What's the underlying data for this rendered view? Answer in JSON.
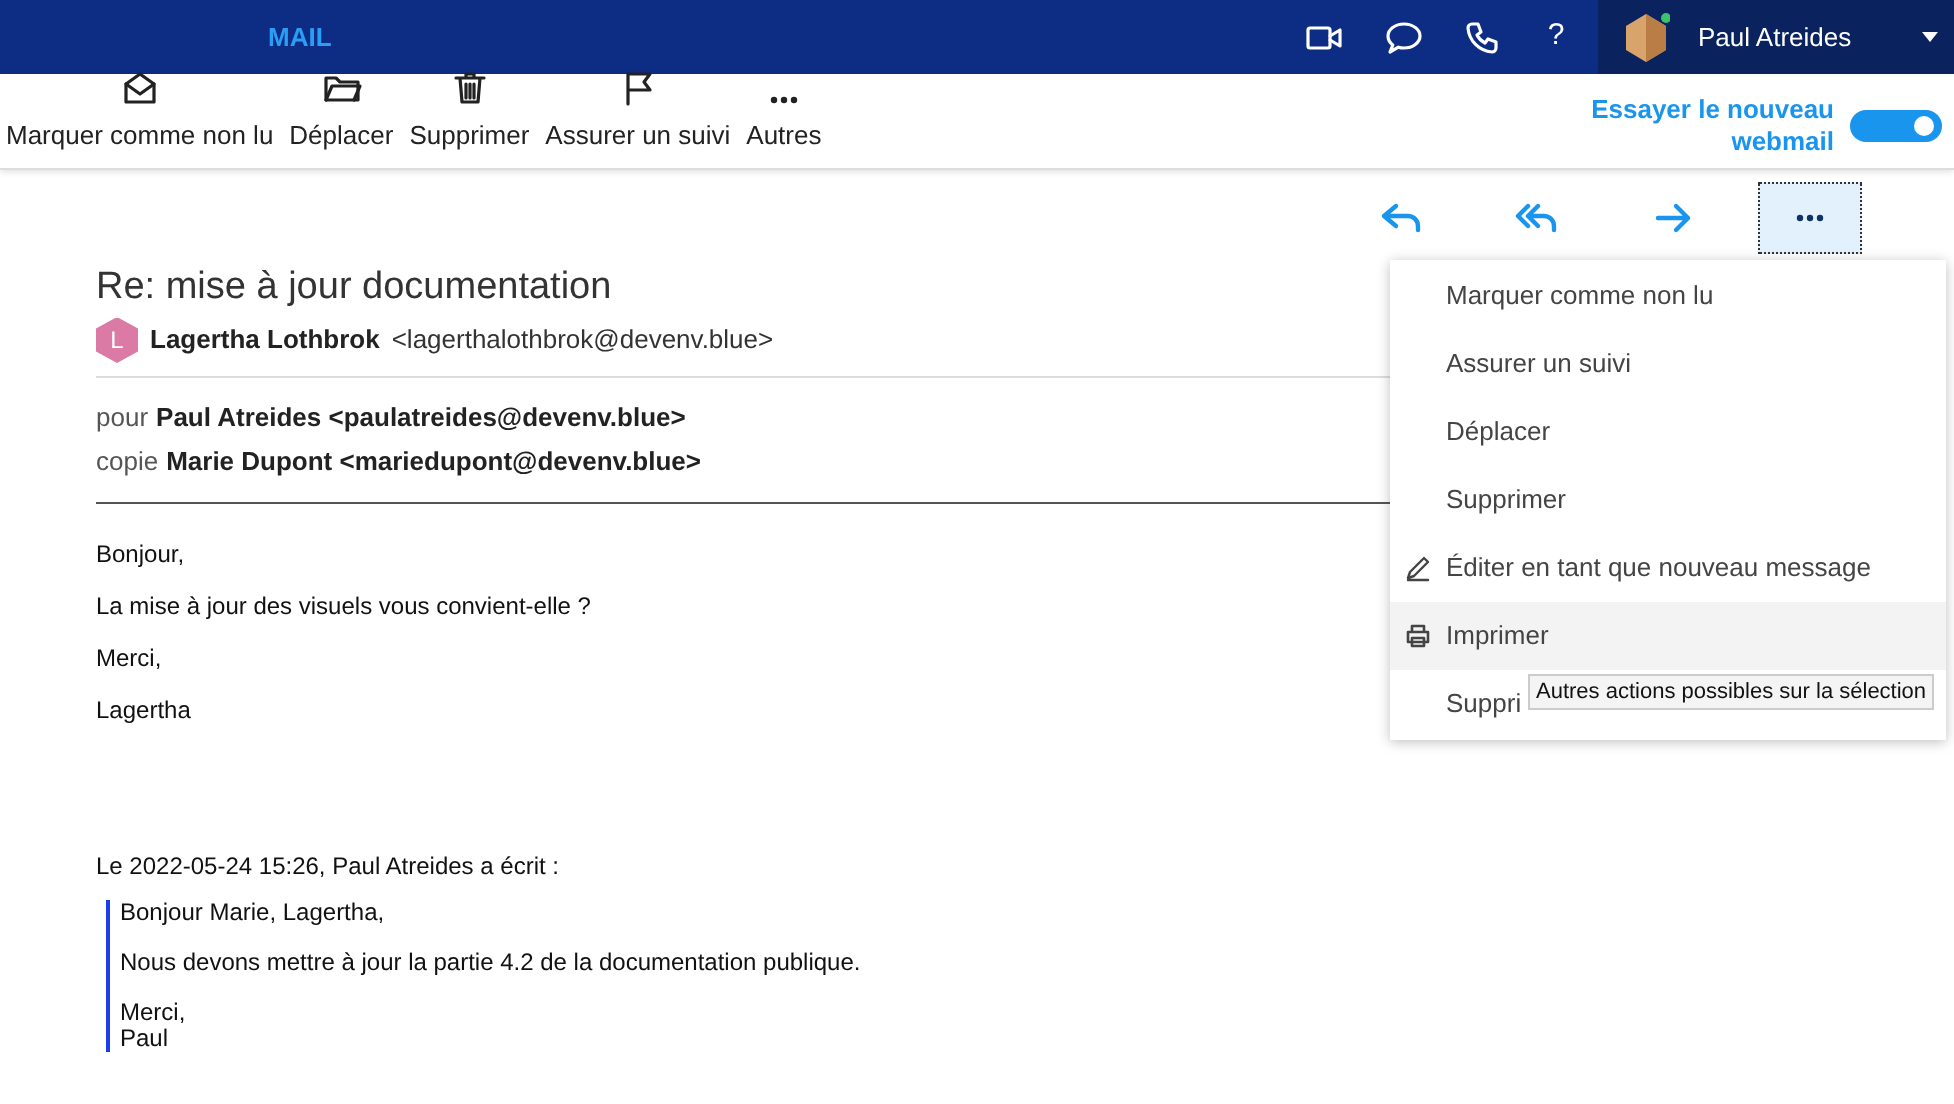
{
  "header": {
    "app_title": "MAIL",
    "help": "?",
    "user": "Paul Atreides"
  },
  "toolbar": {
    "actions": [
      {
        "kind": "unread",
        "label": "Marquer comme non lu"
      },
      {
        "kind": "folder",
        "label": "Déplacer"
      },
      {
        "kind": "trash",
        "label": "Supprimer"
      },
      {
        "kind": "flag",
        "label": "Assurer un suivi"
      },
      {
        "kind": "more",
        "label": "Autres"
      }
    ],
    "toggle": {
      "label": "Essayer le nouveau webmail",
      "on": true
    }
  },
  "message_actions": [
    {
      "kind": "reply",
      "selected": false
    },
    {
      "kind": "reply_all",
      "selected": false
    },
    {
      "kind": "forward",
      "selected": false
    },
    {
      "kind": "more",
      "selected": true
    }
  ],
  "email": {
    "subject": "Re: mise à jour documentation",
    "sender_initial": "L",
    "sender_name": "Lagertha Lothbrok",
    "sender_email": "<lagerthalothbrok@devenv.blue>",
    "to_label": "pour",
    "to": "Paul Atreides <paulatreides@devenv.blue>",
    "cc_label": "copie",
    "cc": "Marie Dupont <mariedupont@devenv.blue>",
    "body": [
      "Bonjour,",
      "La mise à jour des visuels vous convient-elle ?",
      "Merci,",
      "Lagertha"
    ],
    "quote_header": "Le 2022-05-24 15:26, Paul Atreides a écrit :",
    "quote": [
      [
        "Bonjour Marie, Lagertha,"
      ],
      [
        "Nous devons mettre à jour la partie 4.2 de la documentation publique."
      ],
      [
        "Merci,",
        "Paul"
      ]
    ]
  },
  "menu": {
    "items": [
      {
        "kind": "plain",
        "label": "Marquer comme non lu",
        "selected": false
      },
      {
        "kind": "plain",
        "label": "Assurer un suivi",
        "selected": false
      },
      {
        "kind": "plain",
        "label": "Déplacer",
        "selected": false
      },
      {
        "kind": "plain",
        "label": "Supprimer",
        "selected": false
      },
      {
        "kind": "edit",
        "label": "Éditer en tant que nouveau message",
        "selected": false
      },
      {
        "kind": "print",
        "label": "Imprimer",
        "selected": true
      },
      {
        "kind": "plain",
        "label": "Suppri",
        "selected": false
      }
    ]
  },
  "tooltip": "Autres actions possibles sur la sélection"
}
